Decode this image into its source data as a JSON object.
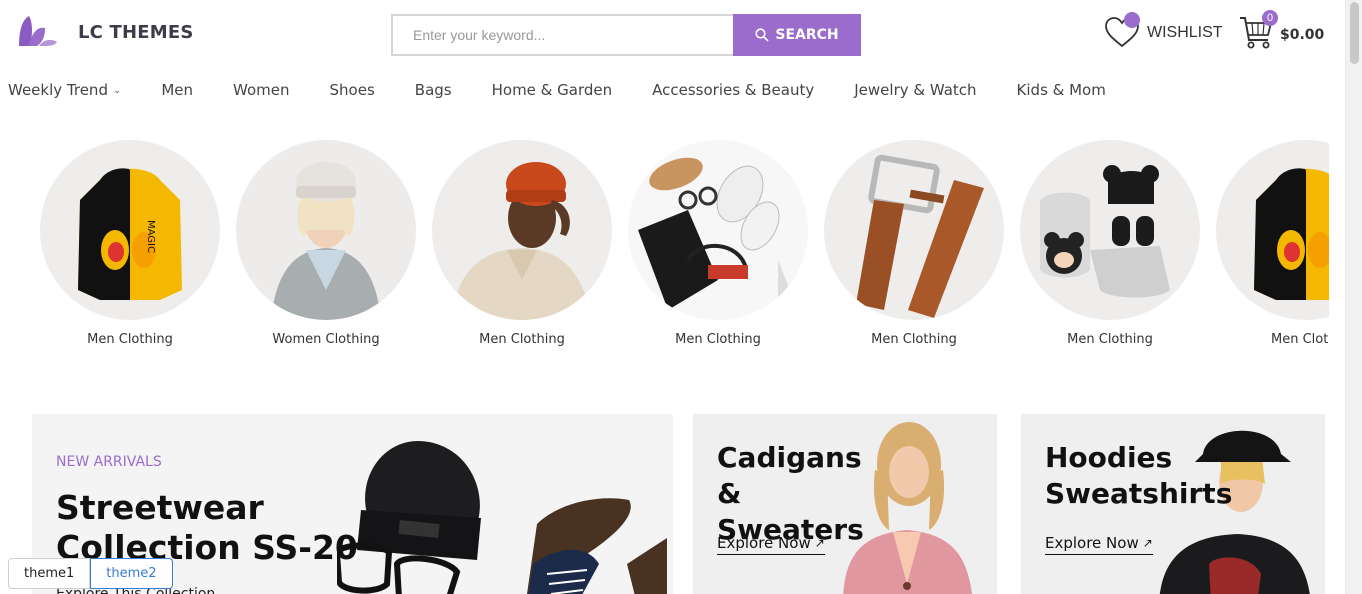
{
  "brand": {
    "name": "LC THEMES",
    "accent": "#9b6ccb"
  },
  "search": {
    "placeholder": "Enter your keyword...",
    "value": "",
    "button_label": "SEARCH"
  },
  "wishlist": {
    "label": "WISHLIST",
    "icon": "heart-icon"
  },
  "cart": {
    "count": "0",
    "total": "$0.00",
    "icon": "cart-icon"
  },
  "nav": {
    "items": [
      {
        "label": "Weekly Trend",
        "has_dropdown": true
      },
      {
        "label": "Men"
      },
      {
        "label": "Women"
      },
      {
        "label": "Shoes"
      },
      {
        "label": "Bags"
      },
      {
        "label": "Home & Garden"
      },
      {
        "label": "Accessories & Beauty"
      },
      {
        "label": "Jewelry & Watch"
      },
      {
        "label": "Kids & Mom"
      }
    ]
  },
  "categories": [
    {
      "label": "Men Clothing",
      "image": "hoodie"
    },
    {
      "label": "Women Clothing",
      "image": "woman-beanie"
    },
    {
      "label": "Men Clothing",
      "image": "man-beanie"
    },
    {
      "label": "Men Clothing",
      "image": "accessories-flatlay"
    },
    {
      "label": "Men Clothing",
      "image": "belt"
    },
    {
      "label": "Men Clothing",
      "image": "baby-set"
    },
    {
      "label": "Men Clothing",
      "image": "hoodie"
    }
  ],
  "banners": {
    "main": {
      "tag": "NEW ARRIVALS",
      "title": "Streetwear Collection SS-20",
      "subtitle": "Explore This Collection"
    },
    "side1": {
      "title": "Cadigans & Sweaters",
      "cta": "Explore Now"
    },
    "side2": {
      "title": "Hoodies Sweatshirts",
      "cta": "Explore Now"
    }
  },
  "theme_switch": {
    "theme1": "theme1",
    "theme2": "theme2",
    "active": "theme2"
  }
}
